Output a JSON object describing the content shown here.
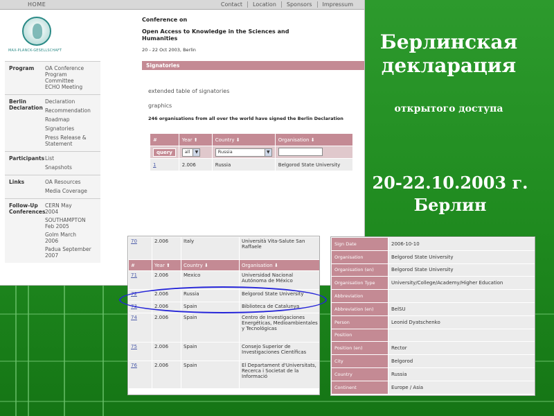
{
  "colors": {
    "background": "#1f8a1f",
    "header_bar": "#c48a94",
    "highlight": "#2525d8",
    "text_light": "#ffffff"
  },
  "browser": {
    "home": "HOME",
    "nav": [
      "Contact",
      "Location",
      "Sponsors",
      "Impressum"
    ],
    "logo_text": "MAX-PLANCK-GESELLSCHAFT",
    "left_nav": [
      {
        "head": "Program",
        "items": [
          "OA Conference",
          "Program Committee",
          "ECHO Meeting"
        ]
      },
      {
        "head": "Berlin Declaration",
        "items": [
          "Declaration",
          "Recommendation",
          "Roadmap",
          "Signatories",
          "Press Release & Statement"
        ]
      },
      {
        "head": "Participants",
        "items": [
          "List",
          "Snapshots"
        ]
      },
      {
        "head": "Links",
        "items": [
          "OA Resources",
          "Media Coverage"
        ]
      },
      {
        "head": "Follow-Up Conferences",
        "items": [
          "CERN May 2004",
          "SOUTHAMPTON Feb 2005",
          "Golm March 2006",
          "Padua September 2007"
        ]
      }
    ],
    "conference_label": "Conference on",
    "conference_title": "Open Access to Knowledge in the Sciences and Humanities",
    "conference_date": "20 - 22 Oct 2003, Berlin",
    "section": "Signatories",
    "link_extended": "extended table of signatories",
    "link_graphics": "graphics",
    "count_text": "246 organisations from all over the world have signed the Berlin Declaration",
    "table": {
      "headers": [
        "#",
        "Year ⬆",
        "Country ⬇",
        "Organisation ⬇"
      ],
      "query_label": "query",
      "year_filter": "all",
      "country_filter": "Russia",
      "row": {
        "num": "1",
        "year": "2.006",
        "country": "Russia",
        "org": "Belgorod State University"
      }
    }
  },
  "title": {
    "line1": "Берлинская",
    "line2": "декларация",
    "subtitle": "открытого доступа",
    "date": "20-22.10.2003 г.",
    "city": "Берлин"
  },
  "list_table": {
    "top_row": {
      "num": "70",
      "year": "2.006",
      "country": "Italy",
      "org": "Università Vita-Salute San Raffaele"
    },
    "headers": [
      "#",
      "Year ⬆",
      "Country ⬇",
      "Organisation ⬇"
    ],
    "rows": [
      {
        "num": "71",
        "year": "2.006",
        "country": "Mexico",
        "org": "Universidad Nacional Autónoma de México"
      },
      {
        "num": "72",
        "year": "2.006",
        "country": "Russia",
        "org": "Belgorod State University"
      },
      {
        "num": "73",
        "year": "2.006",
        "country": "Spain",
        "org": "Biblioteca de Catalunya"
      },
      {
        "num": "74",
        "year": "2.006",
        "country": "Spain",
        "org": "Centro de Investigaciones Energéticas, Medioambientales y Tecnológicas"
      },
      {
        "num": "75",
        "year": "2.006",
        "country": "Spain",
        "org": "Consejo Superior de Investigaciones Científicas"
      },
      {
        "num": "76",
        "year": "2.006",
        "country": "Spain",
        "org": "El Departament d'Universitats, Recerca i Societat de la Informació"
      }
    ]
  },
  "details": [
    {
      "key": "Sign Date",
      "value": "2006-10-10"
    },
    {
      "key": "Organisation",
      "value": "Belgorod State University"
    },
    {
      "key": "Organisation (en)",
      "value": "Belgorod State University"
    },
    {
      "key": "Organisation Type",
      "value": "University/College/Academy/Higher Education"
    },
    {
      "key": "Abbreviation",
      "value": ""
    },
    {
      "key": "Abbreviation (en)",
      "value": "BelSU"
    },
    {
      "key": "Person",
      "value": "Leonid Dyatschenko"
    },
    {
      "key": "Position",
      "value": ""
    },
    {
      "key": "Position (en)",
      "value": "Rector"
    },
    {
      "key": "City",
      "value": "Belgorod"
    },
    {
      "key": "Country",
      "value": "Russia"
    },
    {
      "key": "Continent",
      "value": "Europe / Asia"
    }
  ]
}
